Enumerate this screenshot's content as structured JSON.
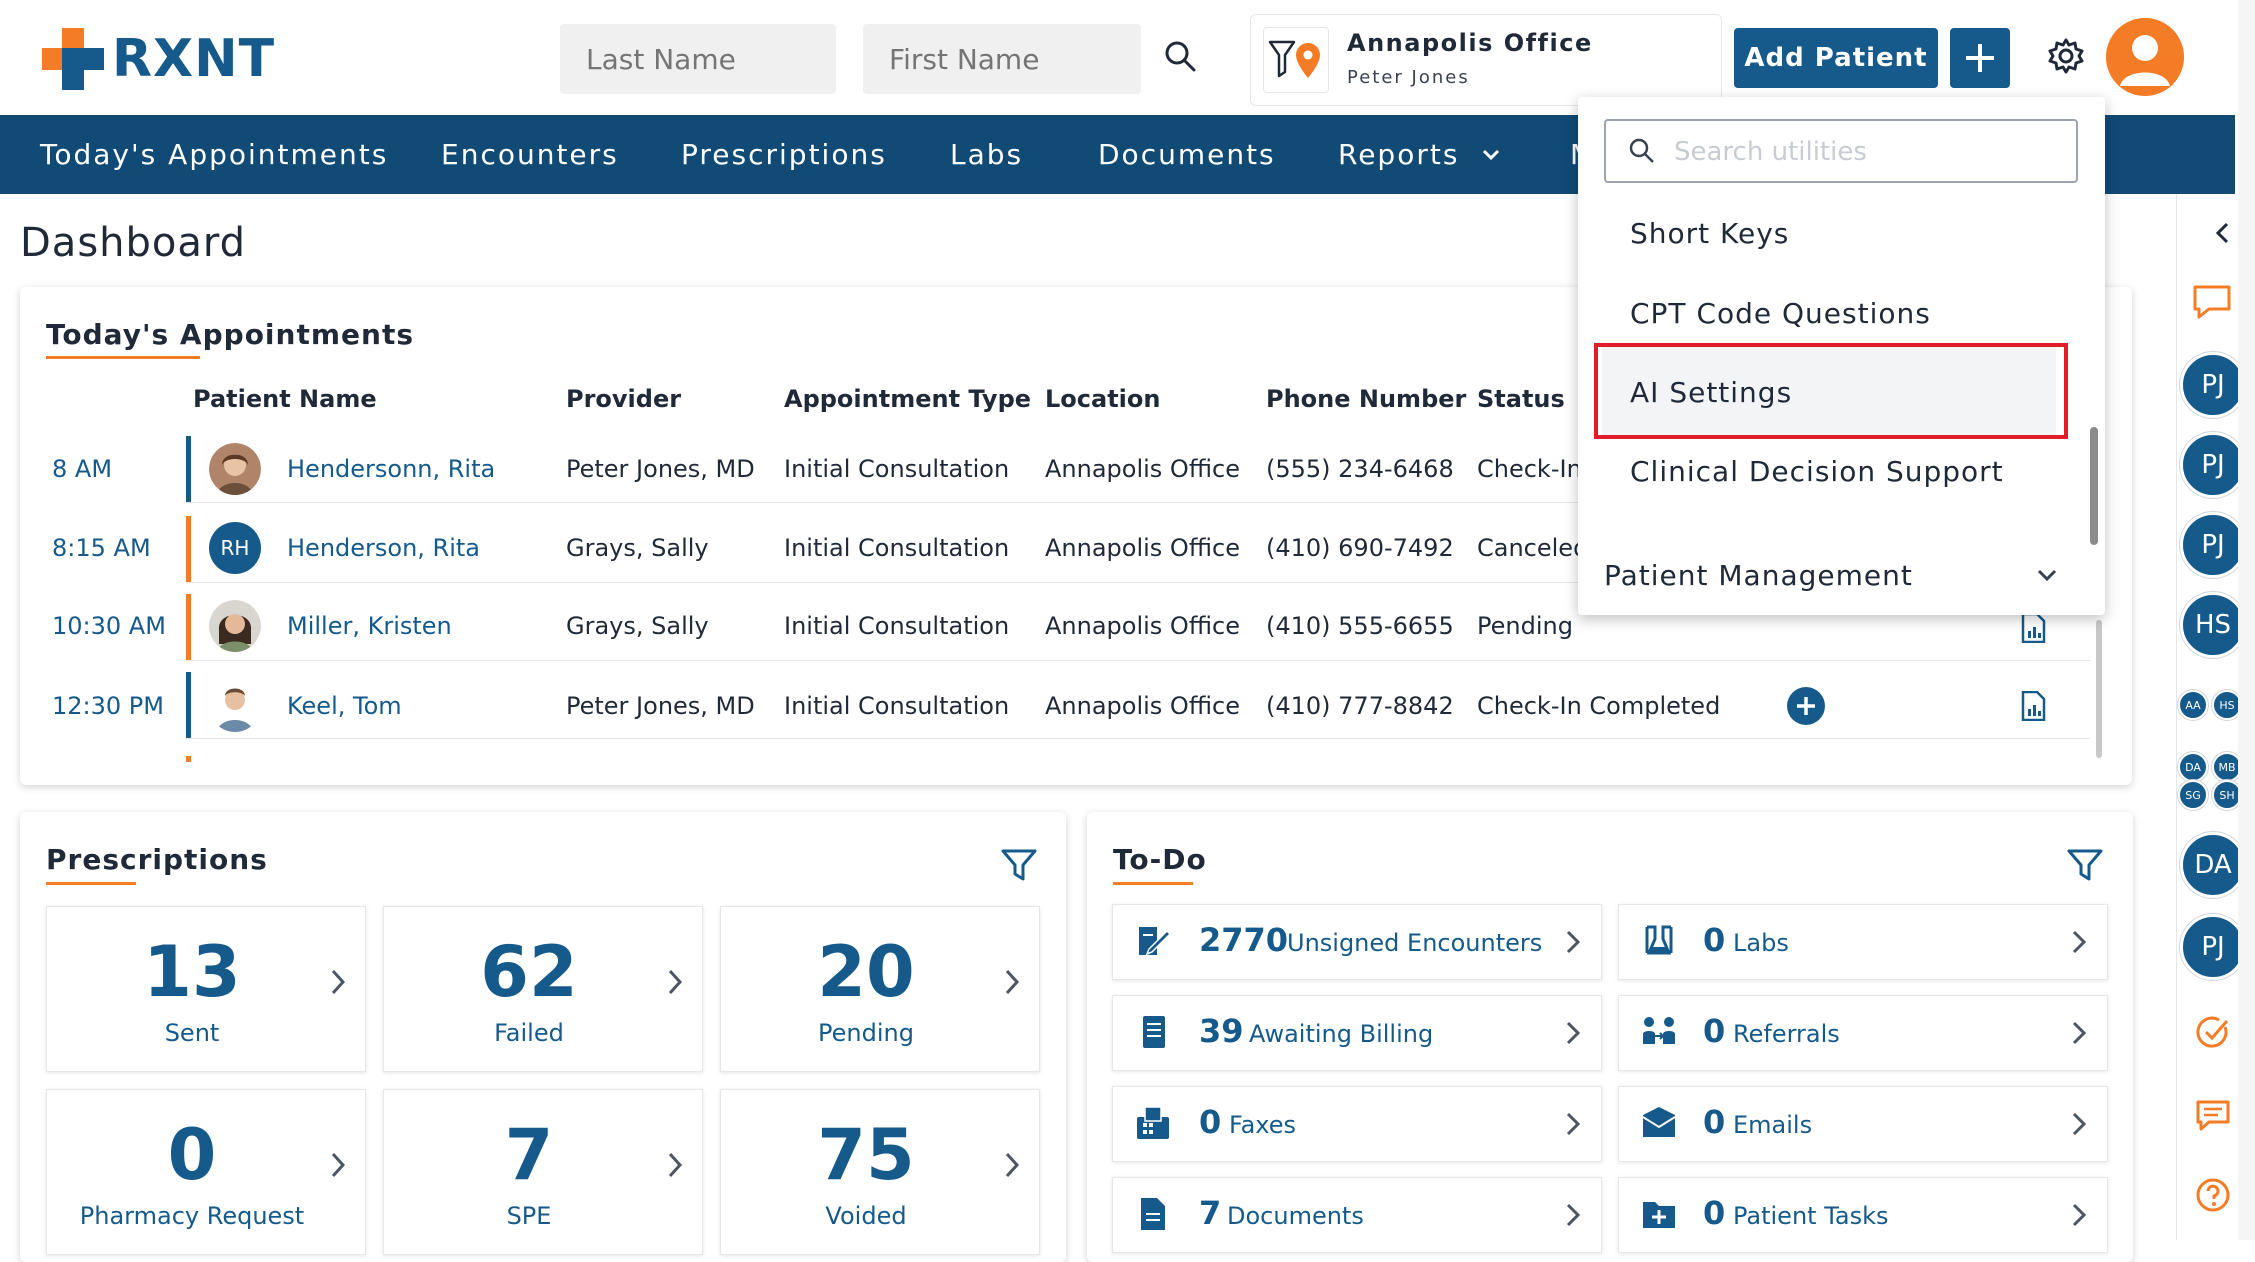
{
  "brand": {
    "name": "RXNT"
  },
  "header": {
    "last_name_placeholder": "Last Name",
    "first_name_placeholder": "First Name",
    "office_name": "Annapolis Office",
    "office_user": "Peter Jones",
    "add_patient_label": "Add Patient"
  },
  "nav": {
    "items": [
      "Today's Appointments",
      "Encounters",
      "Prescriptions",
      "Labs",
      "Documents",
      "Reports",
      "M"
    ]
  },
  "page": {
    "title": "Dashboard"
  },
  "appointments": {
    "title": "Today's Appointments",
    "columns": [
      "Patient Name",
      "Provider",
      "Appointment Type",
      "Location",
      "Phone Number",
      "Status"
    ],
    "rows": [
      {
        "time": "8 AM",
        "patient": "Hendersonn, Rita",
        "provider": "Peter Jones, MD",
        "type": "Initial Consultation",
        "location": "Annapolis Office",
        "phone": "(555) 234-6468",
        "status": "Check-In",
        "bar_color": "#155a8a",
        "avatar": "photo",
        "initials": ""
      },
      {
        "time": "8:15 AM",
        "patient": "Henderson, Rita",
        "provider": "Grays, Sally",
        "type": "Initial Consultation",
        "location": "Annapolis Office",
        "phone": "(410) 690-7492",
        "status": "Canceled",
        "bar_color": "#f47c27",
        "avatar": "initials",
        "initials": "RH"
      },
      {
        "time": "10:30 AM",
        "patient": "Miller, Kristen",
        "provider": "Grays, Sally",
        "type": "Initial Consultation",
        "location": "Annapolis Office",
        "phone": "(410) 555-6655",
        "status": "Pending",
        "bar_color": "#f47c27",
        "avatar": "photo",
        "initials": ""
      },
      {
        "time": "12:30 PM",
        "patient": "Keel, Tom",
        "provider": "Peter Jones, MD",
        "type": "Initial Consultation",
        "location": "Annapolis Office",
        "phone": "(410) 777-8842",
        "status": "Check-In Completed",
        "bar_color": "#155a8a",
        "avatar": "photo",
        "initials": ""
      }
    ]
  },
  "prescriptions": {
    "title": "Prescriptions",
    "stats": [
      {
        "value": "13",
        "label": "Sent"
      },
      {
        "value": "62",
        "label": "Failed"
      },
      {
        "value": "20",
        "label": "Pending"
      },
      {
        "value": "0",
        "label": "Pharmacy Request"
      },
      {
        "value": "7",
        "label": "SPE"
      },
      {
        "value": "75",
        "label": "Voided"
      }
    ]
  },
  "todo": {
    "title": "To-Do",
    "items": [
      {
        "count": "2770",
        "label": "Unsigned Encounters",
        "icon": "sign-document-icon"
      },
      {
        "count": "0",
        "label": "Labs",
        "icon": "flask-icon"
      },
      {
        "count": "39",
        "label": "Awaiting Billing",
        "icon": "billing-icon"
      },
      {
        "count": "0",
        "label": "Referrals",
        "icon": "referral-icon"
      },
      {
        "count": "0",
        "label": "Faxes",
        "icon": "fax-icon"
      },
      {
        "count": "0",
        "label": "Emails",
        "icon": "email-icon"
      },
      {
        "count": "7",
        "label": "Documents",
        "icon": "document-icon"
      },
      {
        "count": "0",
        "label": "Patient Tasks",
        "icon": "task-folder-icon"
      }
    ]
  },
  "utilities_menu": {
    "search_placeholder": "Search utilities",
    "items": [
      "Short Keys",
      "CPT Code Questions",
      "AI Settings",
      "Clinical Decision Support"
    ],
    "selected": "AI Settings",
    "section": "Patient Management"
  },
  "right_rail": {
    "avatars": [
      "PJ",
      "PJ",
      "PJ",
      "HS",
      "DA",
      "PJ"
    ],
    "mini_avatars_row1": [
      "AA",
      "HS"
    ],
    "mini_avatars_row2": [
      "DA",
      "MB",
      "SG",
      "SH"
    ]
  },
  "colors": {
    "brand_blue": "#155a8a",
    "nav_blue": "#104a75",
    "accent_orange": "#f47c27",
    "highlight_red": "#e11d2a"
  }
}
